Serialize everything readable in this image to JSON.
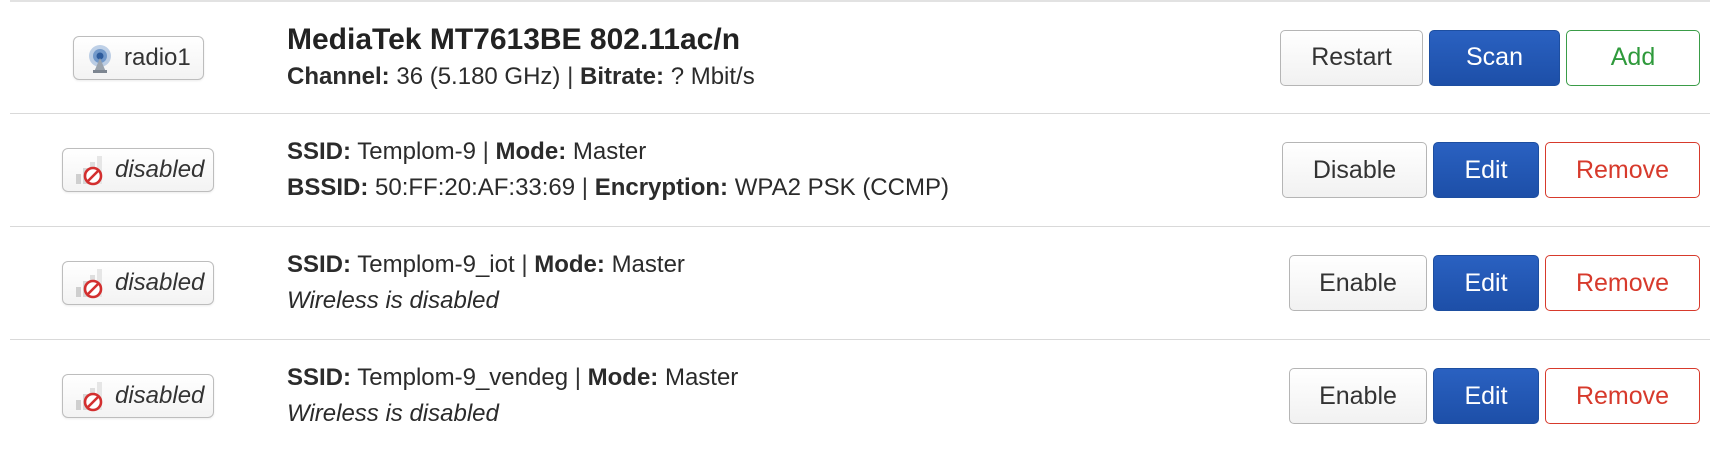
{
  "radio": {
    "badge_label": "radio1",
    "title": "MediaTek MT7613BE 802.11ac/n",
    "channel_label": "Channel:",
    "channel_value": "36 (5.180 GHz)",
    "separator": "|",
    "bitrate_label": "Bitrate:",
    "bitrate_value": "? Mbit/s",
    "buttons": {
      "restart": "Restart",
      "scan": "Scan",
      "add": "Add"
    }
  },
  "networks": [
    {
      "badge_label": "disabled",
      "ssid_label": "SSID:",
      "ssid_value": "Templom-9",
      "mode_label": "Mode:",
      "mode_value": "Master",
      "bssid_label": "BSSID:",
      "bssid_value": "50:FF:20:AF:33:69",
      "encryption_label": "Encryption:",
      "encryption_value": "WPA2 PSK (CCMP)",
      "toggle_label": "Disable",
      "edit_label": "Edit",
      "remove_label": "Remove"
    },
    {
      "badge_label": "disabled",
      "ssid_label": "SSID:",
      "ssid_value": "Templom-9_iot",
      "mode_label": "Mode:",
      "mode_value": "Master",
      "note": "Wireless is disabled",
      "toggle_label": "Enable",
      "edit_label": "Edit",
      "remove_label": "Remove"
    },
    {
      "badge_label": "disabled",
      "ssid_label": "SSID:",
      "ssid_value": "Templom-9_vendeg",
      "mode_label": "Mode:",
      "mode_value": "Master",
      "note": "Wireless is disabled",
      "toggle_label": "Enable",
      "edit_label": "Edit",
      "remove_label": "Remove"
    }
  ],
  "icons": {
    "radio": "wifi-radio-icon",
    "disabled": "signal-disabled-icon"
  },
  "colors": {
    "primary": "#2a61c1",
    "add": "#2f9a3c",
    "remove": "#d73a2c"
  }
}
